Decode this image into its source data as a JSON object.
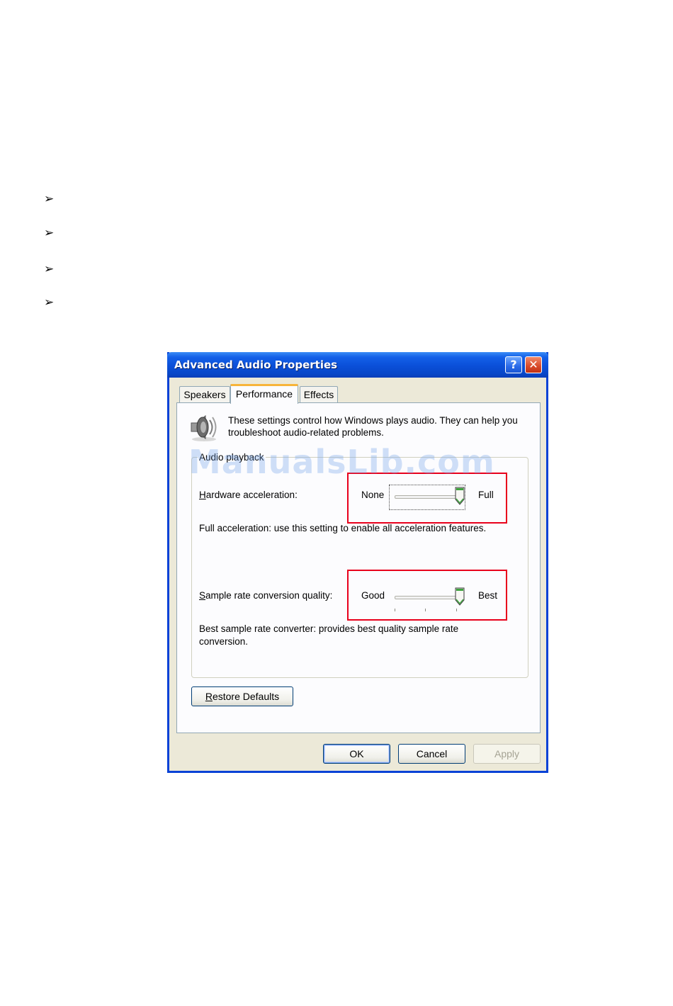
{
  "bullets": [
    "arrow-bullet",
    "arrow-bullet",
    "arrow-bullet",
    "arrow-bullet"
  ],
  "watermark": "ManualsLib.com",
  "dialog": {
    "title": "Advanced Audio Properties",
    "help_glyph": "?",
    "close_glyph": "✕",
    "tabs": [
      {
        "label": "Speakers",
        "active": false
      },
      {
        "label": "Performance",
        "active": true
      },
      {
        "label": "Effects",
        "active": false
      }
    ],
    "intro": "These settings control how Windows plays audio. They can help you troubleshoot audio-related problems.",
    "group_title": "Audio playback",
    "hardware_acceleration": {
      "label_access": "H",
      "label_rest": "ardware acceleration:",
      "min_label": "None",
      "max_label": "Full",
      "level": 1.0,
      "description": "Full acceleration: use this setting to enable all acceleration features."
    },
    "sample_rate": {
      "label_access": "S",
      "label_rest": "ample rate conversion quality:",
      "min_label": "Good",
      "max_label": "Best",
      "level": 1.0,
      "description": "Best sample rate converter: provides best quality sample rate conversion."
    },
    "restore_access": "R",
    "restore_rest": "estore Defaults",
    "buttons": {
      "ok": "OK",
      "cancel": "Cancel",
      "apply": "Apply"
    },
    "colors": {
      "titlebar": "#0a4fd8",
      "highlight": "#e8001c",
      "thumb_accent": "#3fa33f"
    }
  }
}
